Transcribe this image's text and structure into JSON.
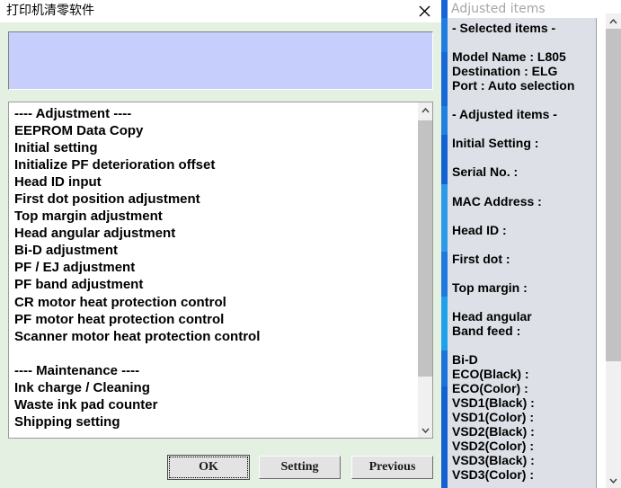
{
  "window": {
    "title": "打印机清零软件",
    "close_icon": "close-icon"
  },
  "status_panel": {
    "value": ""
  },
  "list": {
    "items": [
      "---- Adjustment ----",
      "EEPROM Data Copy",
      "Initial setting",
      "Initialize PF deterioration offset",
      "Head ID input",
      "First dot position adjustment",
      "Top margin adjustment",
      "Head angular adjustment",
      "Bi-D adjustment",
      "PF / EJ adjustment",
      "PF band adjustment",
      "CR motor heat protection control",
      "PF motor heat protection control",
      "Scanner motor heat protection control",
      "",
      "---- Maintenance ----",
      "Ink charge / Cleaning",
      "Waste ink pad counter",
      "Shipping setting"
    ]
  },
  "buttons": {
    "ok": "OK",
    "setting": "Setting",
    "previous": "Previous"
  },
  "right_panel": {
    "header": "Adjusted items",
    "lines": [
      "- Selected items -",
      "",
      "Model Name : L805",
      "Destination : ELG",
      "Port : Auto selection",
      "",
      "- Adjusted items -",
      "",
      "Initial Setting :",
      "",
      "Serial No. :",
      "",
      "MAC Address :",
      "",
      "Head ID :",
      "",
      "First dot :",
      "",
      "Top margin :",
      "",
      "Head angular",
      " Band feed :",
      "",
      "Bi-D",
      " ECO(Black)  :",
      " ECO(Color)  :",
      " VSD1(Black) :",
      " VSD1(Color) :",
      " VSD2(Black) :",
      " VSD2(Color) :",
      " VSD3(Black) :",
      " VSD3(Color) :"
    ]
  },
  "scrollbars": {
    "up_arrow": "chevron-up-icon",
    "down_arrow": "chevron-down-icon"
  },
  "colors": {
    "dialog_background": "#e4f0e2",
    "status_panel": "#c6cffb",
    "right_accent": "#1565d8",
    "right_content_background": "#dde1e7",
    "header_text": "#a6a6a6"
  }
}
